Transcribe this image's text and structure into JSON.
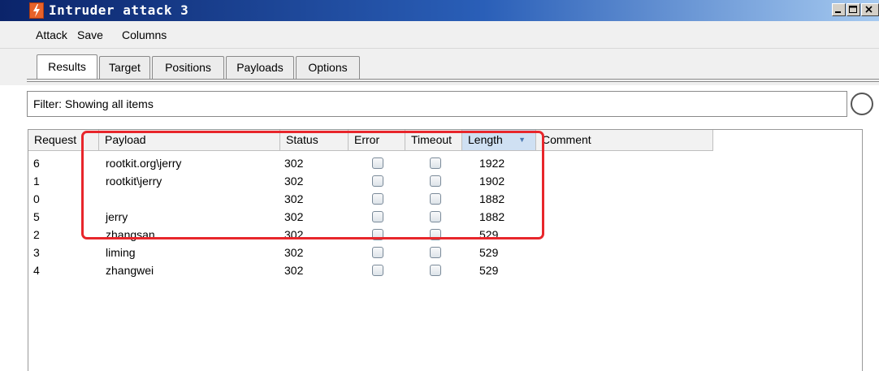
{
  "window": {
    "title": "Intruder attack 3",
    "icon": "burp-lightning-icon"
  },
  "menu": [
    "Attack",
    "Save",
    "Columns"
  ],
  "tabs": [
    {
      "label": "Results",
      "active": true
    },
    {
      "label": "Target",
      "active": false
    },
    {
      "label": "Positions",
      "active": false
    },
    {
      "label": "Payloads",
      "active": false
    },
    {
      "label": "Options",
      "active": false
    }
  ],
  "filter": {
    "text": "Filter: Showing all items"
  },
  "table": {
    "columns": [
      "Request",
      "Payload",
      "Status",
      "Error",
      "Timeout",
      "Length",
      "Comment"
    ],
    "sorted_column": "Length",
    "sort_direction": "descending",
    "rows": [
      {
        "request": "6",
        "payload": "rootkit.org\\jerry",
        "status": "302",
        "error": false,
        "timeout": false,
        "length": "1922",
        "comment": ""
      },
      {
        "request": "1",
        "payload": "rootkit\\jerry",
        "status": "302",
        "error": false,
        "timeout": false,
        "length": "1902",
        "comment": ""
      },
      {
        "request": "0",
        "payload": "",
        "status": "302",
        "error": false,
        "timeout": false,
        "length": "1882",
        "comment": ""
      },
      {
        "request": "5",
        "payload": "jerry",
        "status": "302",
        "error": false,
        "timeout": false,
        "length": "1882",
        "comment": ""
      },
      {
        "request": "2",
        "payload": "zhangsan",
        "status": "302",
        "error": false,
        "timeout": false,
        "length": "529",
        "comment": ""
      },
      {
        "request": "3",
        "payload": "liming",
        "status": "302",
        "error": false,
        "timeout": false,
        "length": "529",
        "comment": ""
      },
      {
        "request": "4",
        "payload": "zhangwei",
        "status": "302",
        "error": false,
        "timeout": false,
        "length": "529",
        "comment": ""
      }
    ]
  },
  "annotation": {
    "color": "#e8262b",
    "highlighted_rows": 4
  },
  "colors": {
    "title_bar": "#0b246a",
    "sorted_header": "#cfe0f3"
  }
}
